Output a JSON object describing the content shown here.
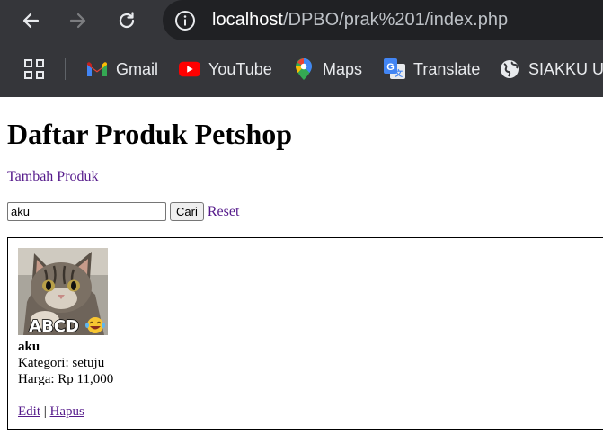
{
  "browser": {
    "url_host": "localhost",
    "url_path": "/DPBO/prak%201/index.php",
    "bookmarks": [
      {
        "label": "Gmail",
        "icon": "gmail-icon"
      },
      {
        "label": "YouTube",
        "icon": "youtube-icon"
      },
      {
        "label": "Maps",
        "icon": "maps-icon"
      },
      {
        "label": "Translate",
        "icon": "translate-icon"
      },
      {
        "label": "SIAKKU UPI",
        "icon": "globe-icon"
      }
    ]
  },
  "page": {
    "title": "Daftar Produk Petshop",
    "add_link": "Tambah Produk",
    "search": {
      "value": "aku",
      "button": "Cari",
      "reset": "Reset"
    },
    "products": [
      {
        "image_caption": "ABCD",
        "name": "aku",
        "category_line": "Kategori: setuju",
        "price_line": "Harga: Rp 11,000",
        "edit": "Edit",
        "separator": "|",
        "delete": "Hapus"
      }
    ]
  },
  "colors": {
    "chrome_bg": "#35363a",
    "omnibox_bg": "#202124",
    "link_visited": "#551a8b"
  }
}
